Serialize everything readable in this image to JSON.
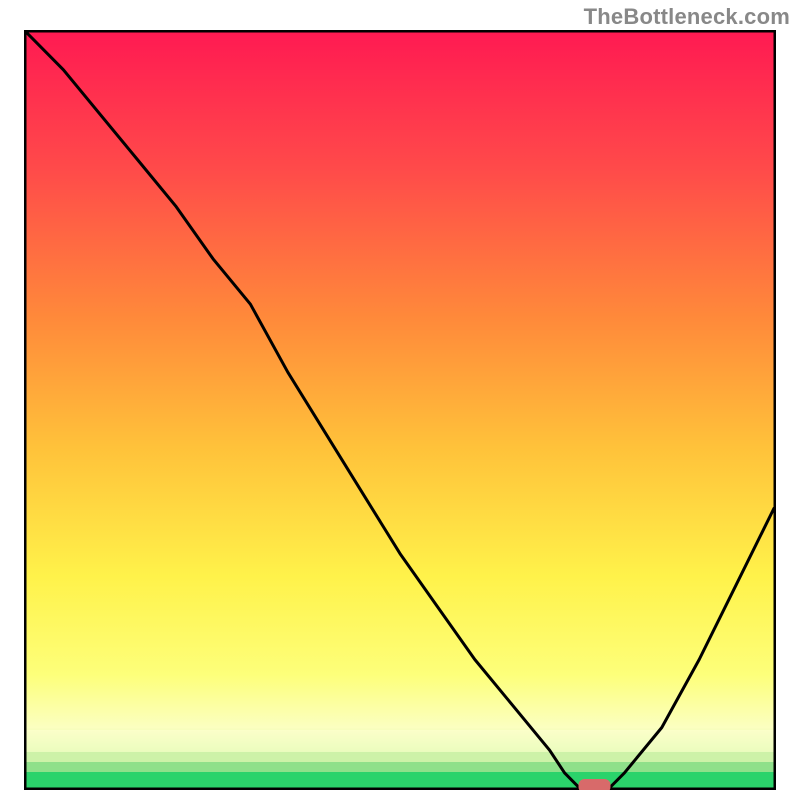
{
  "watermark_text": "TheBottleneck.com",
  "colors": {
    "top_gradient": "#ff1a52",
    "mid_upper": "#ff7a3c",
    "mid": "#ffd23c",
    "mid_lower": "#fff64d",
    "pale_band": "#fdffb8",
    "green_band_top": "#9de67a",
    "green_band_bottom": "#22d36b",
    "frame": "#000000",
    "curve": "#000000",
    "marker": "#d86a6a",
    "watermark": "#888888"
  },
  "chart_data": {
    "type": "line",
    "title": "",
    "xlabel": "",
    "ylabel": "",
    "xlim": [
      0,
      100
    ],
    "ylim": [
      0,
      100
    ],
    "x": [
      0,
      5,
      10,
      15,
      20,
      25,
      30,
      35,
      40,
      45,
      50,
      55,
      60,
      65,
      70,
      72,
      74,
      76,
      78,
      80,
      85,
      90,
      95,
      100
    ],
    "y": [
      100,
      95,
      89,
      83,
      77,
      70,
      64,
      55,
      47,
      39,
      31,
      24,
      17,
      11,
      5,
      2,
      0,
      0,
      0,
      2,
      8,
      17,
      27,
      37
    ],
    "marker": {
      "x": 76,
      "y": 0
    },
    "notes": "Y estimated as percentage of plot height from bottom; gradient background red→orange→yellow→pale→green; black V-shaped curve with minimum near x≈75 and small flat segment at y≈0; small rounded pink marker at minimum."
  }
}
